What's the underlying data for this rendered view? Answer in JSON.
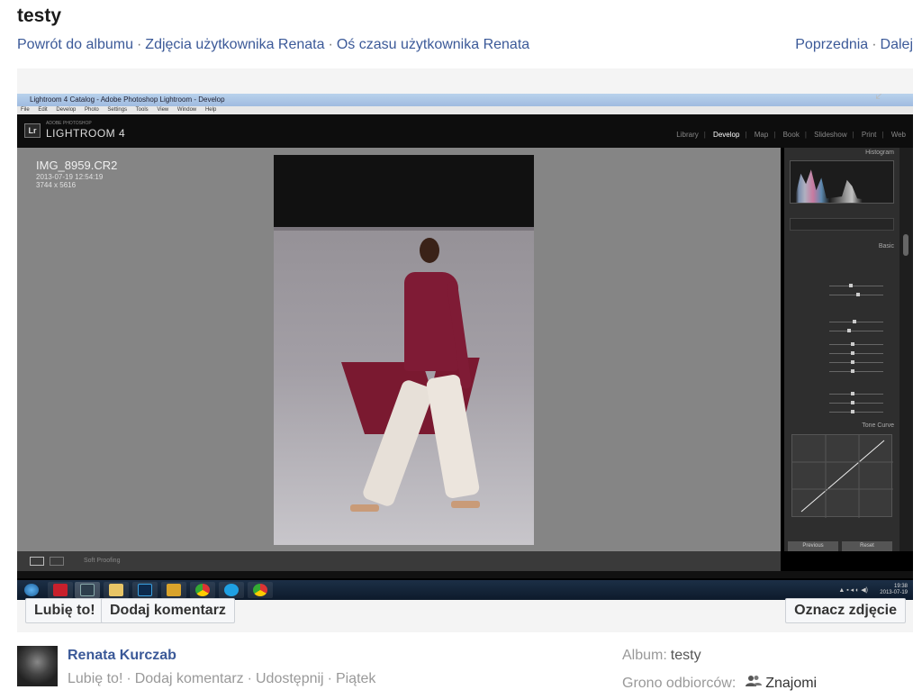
{
  "page": {
    "title": "testy"
  },
  "nav": {
    "back_to_album": "Powrót do albumu",
    "user_photos": "Zdjęcia użytkownika Renata",
    "user_timeline": "Oś czasu użytkownika Renata",
    "prev": "Poprzednia",
    "next": "Dalej",
    "separator": "·"
  },
  "screenshot": {
    "window_title": "Lightroom 4 Catalog - Adobe Photoshop Lightroom - Develop",
    "menu": [
      "File",
      "Edit",
      "Develop",
      "Photo",
      "Settings",
      "Tools",
      "View",
      "Window",
      "Help"
    ],
    "lr_brand_small": "ADOBE PHOTOSHOP",
    "lr_brand": "LIGHTROOM 4",
    "modules": [
      "Library",
      "Develop",
      "Map",
      "Book",
      "Slideshow",
      "Print",
      "Web"
    ],
    "active_module": "Develop",
    "image_name": "IMG_8959.CR2",
    "image_date": "2013-07-19 12:54:19",
    "image_size": "3744 x 5616",
    "histogram_label": "Histogram",
    "basic_label": "Basic",
    "tone_curve_label": "Tone Curve",
    "toolbar_label": "Soft Proofing",
    "previous_btn": "Previous",
    "reset_btn": "Reset",
    "clock_time": "19:38",
    "clock_date": "2013-07-19"
  },
  "buttons": {
    "like": "Lubię to!",
    "comment": "Dodaj komentarz",
    "tag": "Oznacz zdjęcie"
  },
  "footer": {
    "author": "Renata Kurczab",
    "like": "Lubię to!",
    "comment": "Dodaj komentarz",
    "share": "Udostępnij",
    "day": "Piątek",
    "album_label": "Album:",
    "album_value": "testy",
    "audience_label": "Grono odbiorców:",
    "audience_value": "Znajomi"
  }
}
